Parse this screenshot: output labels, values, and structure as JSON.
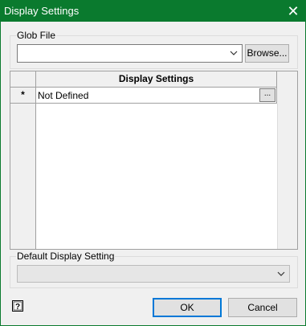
{
  "window": {
    "title": "Display Settings",
    "close_glyph": "✕",
    "close_icon": "close-icon"
  },
  "glob_file": {
    "label": "Glob File",
    "value": "",
    "browse_label": "Browse..."
  },
  "grid": {
    "column_header": "Display Settings",
    "rows": [
      {
        "marker": "*",
        "value": "Not Defined",
        "button_label": "..."
      }
    ]
  },
  "default_display": {
    "label": "Default Display Setting",
    "value": ""
  },
  "footer": {
    "help_icon": "help-icon",
    "ok_label": "OK",
    "cancel_label": "Cancel"
  },
  "colors": {
    "titlebar": "#0a7a2e",
    "accent": "#0078d7"
  }
}
